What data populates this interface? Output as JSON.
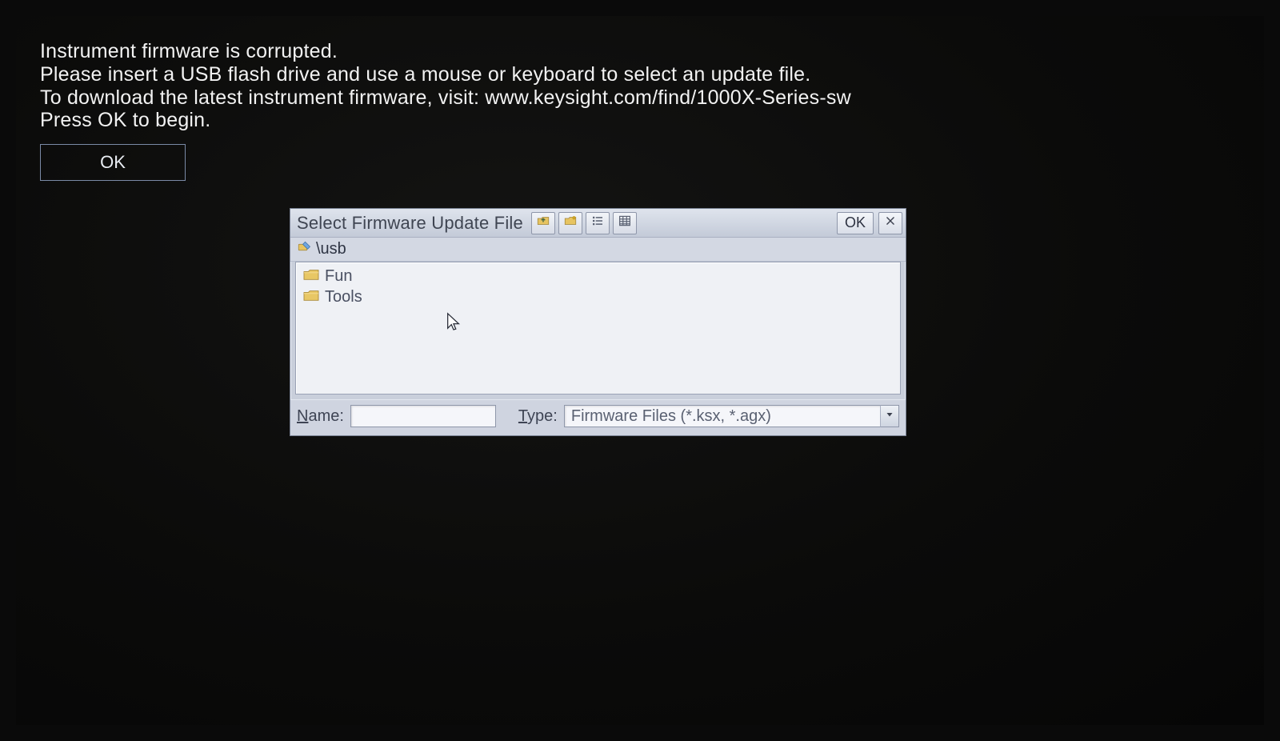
{
  "message": {
    "line1": "Instrument firmware is corrupted.",
    "line2": "Please insert a USB flash drive and use a mouse or keyboard to select an update file.",
    "line3": "To download the latest instrument firmware, visit:  www.keysight.com/find/1000X-Series-sw",
    "line4": "Press OK to begin.",
    "ok_label": "OK"
  },
  "dialog": {
    "title": "Select Firmware Update File",
    "ok_label": "OK",
    "path": "\\usb",
    "items": [
      {
        "name": "Fun"
      },
      {
        "name": "Tools"
      }
    ],
    "name_label_u": "N",
    "name_label_rest": "ame:",
    "name_value": "",
    "type_label_u": "T",
    "type_label_rest": "ype:",
    "type_value": "Firmware Files (*.ksx, *.agx)"
  }
}
